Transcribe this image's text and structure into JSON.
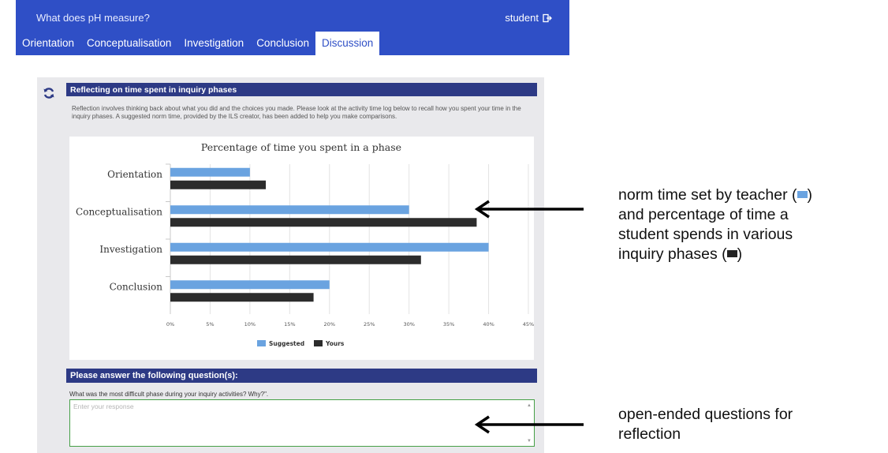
{
  "header": {
    "title": "What does pH measure?",
    "user": "student",
    "logout_icon": "logout-icon"
  },
  "tabs": [
    {
      "label": "Orientation",
      "active": false
    },
    {
      "label": "Conceptualisation",
      "active": false
    },
    {
      "label": "Investigation",
      "active": false
    },
    {
      "label": "Conclusion",
      "active": false
    },
    {
      "label": "Discussion",
      "active": true
    }
  ],
  "reflection": {
    "refresh_icon": "refresh-icon",
    "header": "Reflecting on time spent in inquiry phases",
    "intro": "Reflection involves thinking back about what you did and the choices you made. Please look at the activity time log below to recall how you spent your time in the inquiry phases. A suggested norm time, provided by the ILS creator, has been added to help you make comparisons."
  },
  "chart_data": {
    "type": "bar",
    "orientation": "horizontal",
    "title": "Percentage of time you spent in a phase",
    "categories": [
      "Orientation",
      "Conceptualisation",
      "Investigation",
      "Conclusion"
    ],
    "series": [
      {
        "name": "Suggested",
        "color": "#6aa3e0",
        "values": [
          10,
          30,
          40,
          20
        ]
      },
      {
        "name": "Yours",
        "color": "#2c2c2c",
        "values": [
          12,
          38.5,
          31.5,
          18
        ]
      }
    ],
    "xlim": [
      0,
      45
    ],
    "ticks": [
      0,
      5,
      10,
      15,
      20,
      25,
      30,
      35,
      40,
      45
    ],
    "tick_labels": [
      "0%",
      "5%",
      "10%",
      "15%",
      "20%",
      "25%",
      "30%",
      "35%",
      "40%",
      "45%"
    ],
    "grid": true,
    "legend": "bottom"
  },
  "questions": {
    "header": "Please answer the following question(s):",
    "question": "What was the most difficult phase during your inquiry activities? Why?\".",
    "placeholder": "Enter your response"
  },
  "annotations": {
    "chart_line1": "norm time set by teacher (",
    "chart_line1_end": ")",
    "chart_line2": "and percentage of time a",
    "chart_line3": "student spends in various",
    "chart_line4": "inquiry phases (",
    "chart_line4_end": ")",
    "questions_line1": "open-ended questions for",
    "questions_line2": "reflection"
  },
  "colors": {
    "topbar": "#2f4fc6",
    "section_header": "#2d3a85",
    "suggested": "#6aa3e0",
    "yours": "#2c2c2c",
    "response_border": "#46a046"
  }
}
